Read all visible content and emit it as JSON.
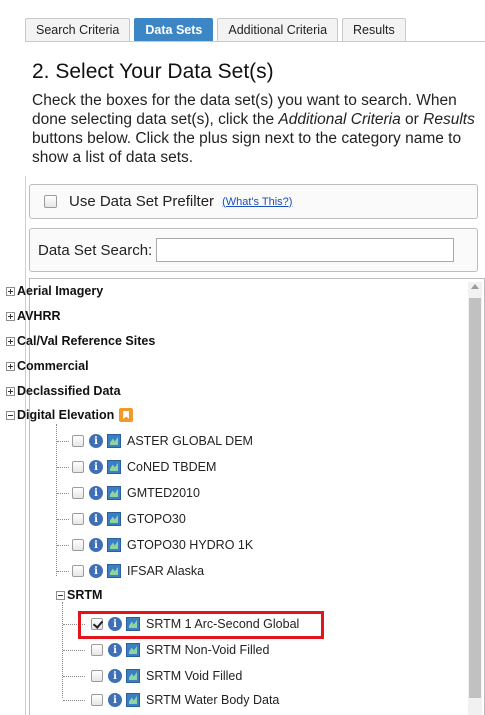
{
  "tabs": [
    {
      "label": "Search Criteria",
      "active": false
    },
    {
      "label": "Data Sets",
      "active": true
    },
    {
      "label": "Additional Criteria",
      "active": false
    },
    {
      "label": "Results",
      "active": false
    }
  ],
  "heading": "2. Select Your Data Set(s)",
  "intro": {
    "part1": "Check the boxes for the data set(s) you want to search. When done selecting data set(s), click the ",
    "em1": "Additional Criteria",
    "part2": " or ",
    "em2": "Results",
    "part3": " buttons below. Click the plus sign next to the category name to show a list of data sets."
  },
  "prefilter": {
    "label": "Use Data Set Prefilter",
    "help_link": "(What's This?)",
    "checked": false
  },
  "search": {
    "label": "Data Set Search:",
    "value": ""
  },
  "tree": {
    "categories": [
      {
        "label": "Aerial Imagery",
        "expanded": false
      },
      {
        "label": "AVHRR",
        "expanded": false
      },
      {
        "label": "Cal/Val Reference Sites",
        "expanded": false
      },
      {
        "label": "Commercial",
        "expanded": false
      },
      {
        "label": "Declassified Data",
        "expanded": false
      },
      {
        "label": "Digital Elevation",
        "expanded": true
      }
    ],
    "digital_elevation_items": [
      {
        "label": "ASTER GLOBAL DEM",
        "checked": false
      },
      {
        "label": "CoNED TBDEM",
        "checked": false
      },
      {
        "label": "GMTED2010",
        "checked": false
      },
      {
        "label": "GTOPO30",
        "checked": false
      },
      {
        "label": "GTOPO30 HYDRO 1K",
        "checked": false
      },
      {
        "label": "IFSAR Alaska",
        "checked": false
      }
    ],
    "subcategory": {
      "label": "SRTM",
      "expanded": true
    },
    "srtm_items": [
      {
        "label": "SRTM 1 Arc-Second Global",
        "checked": true
      },
      {
        "label": "SRTM Non-Void Filled",
        "checked": false
      },
      {
        "label": "SRTM Void Filled",
        "checked": false
      },
      {
        "label": "SRTM Water Body Data",
        "checked": false
      }
    ]
  },
  "colors": {
    "active_tab": "#3d86c6",
    "highlight_box": "#e3141c",
    "link": "#1a4fc0"
  }
}
